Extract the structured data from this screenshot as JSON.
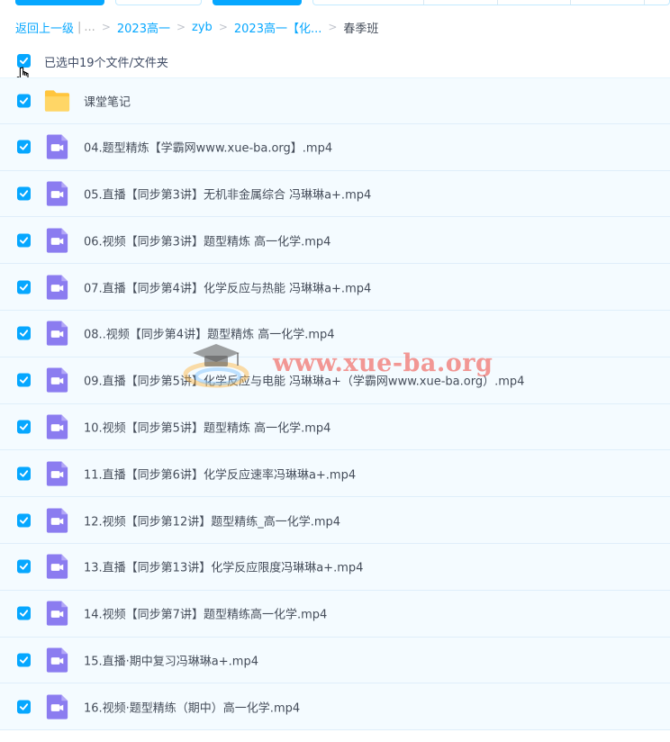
{
  "breadcrumb": {
    "back_label": "返回上一级",
    "divider": "|",
    "ellipsis": "...",
    "sep": ">",
    "items": [
      "2023高一",
      "zyb",
      "2023高一【化..."
    ],
    "current": "春季班"
  },
  "selection": {
    "label": "已选中19个文件/文件夹",
    "checked": true
  },
  "files": [
    {
      "name": "课堂笔记",
      "icon": "folder-icon",
      "checked": true
    },
    {
      "name": "04.题型精炼【学霸网www.xue-ba.org】.mp4",
      "icon": "video-file-icon",
      "checked": true
    },
    {
      "name": "05.直播【同步第3讲】无机非金属综合 冯琳琳a+.mp4",
      "icon": "video-file-icon",
      "checked": true
    },
    {
      "name": "06.视频【同步第3讲】题型精炼 高一化学.mp4",
      "icon": "video-file-icon",
      "checked": true
    },
    {
      "name": "07.直播【同步第4讲】化学反应与热能 冯琳琳a+.mp4",
      "icon": "video-file-icon",
      "checked": true
    },
    {
      "name": "08..视频【同步第4讲】题型精炼 高一化学.mp4",
      "icon": "video-file-icon",
      "checked": true
    },
    {
      "name": "09.直播【同步第5讲】化学反应与电能 冯琳琳a+（学霸网www.xue-ba.org）.mp4",
      "icon": "video-file-icon",
      "checked": true
    },
    {
      "name": "10.视频【同步第5讲】题型精炼 高一化学.mp4",
      "icon": "video-file-icon",
      "checked": true
    },
    {
      "name": "11.直播【同步第6讲】化学反应速率冯琳琳a+.mp4",
      "icon": "video-file-icon",
      "checked": true
    },
    {
      "name": "12.视频【同步第12讲】题型精练_高一化学.mp4",
      "icon": "video-file-icon",
      "checked": true
    },
    {
      "name": "13.直播【同步第13讲】化学反应限度冯琳琳a+.mp4",
      "icon": "video-file-icon",
      "checked": true
    },
    {
      "name": "14.视频【同步第7讲】题型精练高一化学.mp4",
      "icon": "video-file-icon",
      "checked": true
    },
    {
      "name": "15.直播·期中复习冯琳琳a+.mp4",
      "icon": "video-file-icon",
      "checked": true
    },
    {
      "name": "16.视频·题型精练（期中）高一化学.mp4",
      "icon": "video-file-icon",
      "checked": true
    }
  ],
  "watermark": {
    "text": "www.xue-ba.org"
  },
  "colors": {
    "accent": "#06a7ff",
    "row_bg": "#f4fbff",
    "video_icon": "#8b7cf0",
    "folder_icon": "#ffc53d"
  }
}
